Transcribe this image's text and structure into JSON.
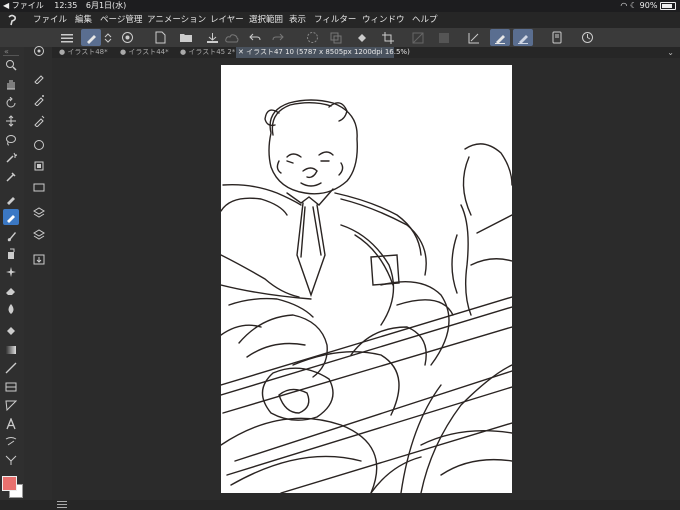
{
  "status_bar": {
    "back_label": "◀ ファイル",
    "time": "12:35",
    "date": "6月1日(水)",
    "battery": "90%"
  },
  "menu": {
    "items": [
      "ファイル",
      "編集",
      "ページ管理",
      "アニメーション",
      "レイヤー",
      "選択範囲",
      "表示",
      "フィルター",
      "ウィンドウ",
      "ヘルプ"
    ]
  },
  "tabs": [
    {
      "label": "● イラスト48*"
    },
    {
      "label": "● イラスト44*"
    },
    {
      "label": "● イラスト45 2*"
    },
    {
      "label": "✕ イラスト47 10 (5787 x 8505px 1200dpi 16.5%)"
    }
  ],
  "colors": {
    "main_color": "#e8706e",
    "sub_color": "#ffffff",
    "active_tool": "#3b78c4",
    "active_toolbar": "#5a6e90"
  },
  "icons": {
    "toolbar": [
      "menu-icon",
      "brush-mode-icon",
      "updown-icon",
      "settings-icon",
      "new-file-icon",
      "open-icon",
      "save-icon",
      "cloud-icon",
      "undo-icon",
      "redo-icon",
      "busy-icon",
      "copy-icon",
      "fill-icon",
      "crop-icon",
      "transform-icon",
      "clear-icon",
      "ruler-icon",
      "pen-active-icon",
      "pen-settings-icon",
      "tablet-icon",
      "history-icon"
    ],
    "tools": [
      "zoom-icon",
      "hand-icon",
      "rotate-icon",
      "move-icon",
      "lasso-icon",
      "magic-wand-icon",
      "eyedropper-icon",
      "pen-icon",
      "pencil-icon",
      "brush-icon",
      "airbrush-icon",
      "decorate-icon",
      "eraser-icon",
      "blend-icon",
      "fill-icon",
      "gradient-icon",
      "line-icon",
      "frame-icon",
      "ruler-icon",
      "text-icon",
      "balloon-icon",
      "correct-line-icon"
    ]
  }
}
